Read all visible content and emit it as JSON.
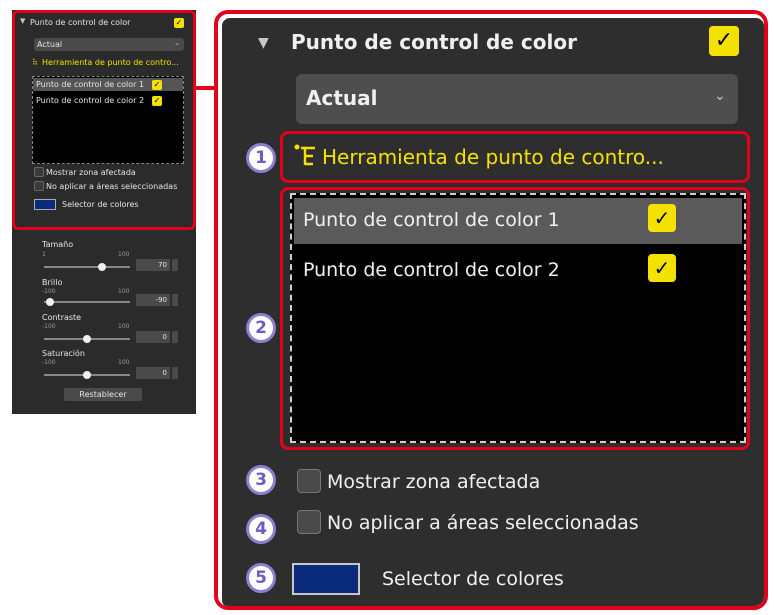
{
  "thumbnail": {
    "title": "Punto de control de color",
    "dropdown": "Actual",
    "tool": "Herramienta de punto de contro...",
    "points": [
      "Punto de control de color 1",
      "Punto de control de color 2"
    ],
    "show_affected": "Mostrar zona afectada",
    "no_apply": "No aplicar a áreas seleccionadas",
    "color_picker": "Selector de colores",
    "sliders": [
      {
        "label": "Tamaño",
        "min": "1",
        "max": "100",
        "value": "70"
      },
      {
        "label": "Brillo",
        "min": "-100",
        "max": "100",
        "value": "-90"
      },
      {
        "label": "Contraste",
        "min": "-100",
        "max": "100",
        "value": "0"
      },
      {
        "label": "Saturación",
        "min": "-100",
        "max": "100",
        "value": "0"
      }
    ],
    "reset_button": "Restablecer"
  },
  "panel": {
    "title": "Punto de control de color",
    "enabled_check": "✓",
    "dropdown": "Actual",
    "tool": "Herramienta de punto de contro...",
    "points": [
      {
        "label": "Punto de control de color 1",
        "checked": "✓"
      },
      {
        "label": "Punto de control de color 2",
        "checked": "✓"
      }
    ],
    "show_affected": "Mostrar zona afectada",
    "no_apply": "No aplicar a áreas seleccionadas",
    "color_picker": "Selector de colores",
    "swatch_color": "#0a2a7a"
  },
  "callouts": [
    "1",
    "2",
    "3",
    "4",
    "5"
  ],
  "colors": {
    "highlight": "#e2001a",
    "accent": "#f5e100",
    "badge": "#8b7fd0"
  }
}
